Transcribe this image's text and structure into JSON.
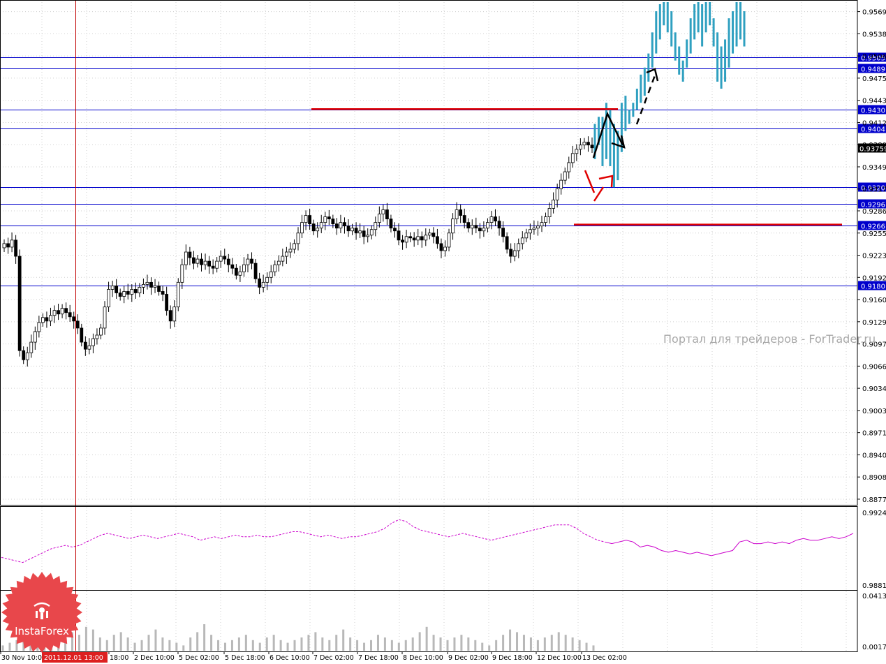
{
  "watermark": "Портал для трейдеров - ForTrader.ru",
  "logo": {
    "text": "InstaForex",
    "color": "#e8474b"
  },
  "colors": {
    "candle": "#000000",
    "projection": "#2fa0c0",
    "level": "#0000cc",
    "red_line": "#e00000",
    "indicator": "#cc00cc",
    "volume": "#b8b8b8",
    "vline": "#c00000"
  },
  "chart_data": [
    {
      "type": "candlestick",
      "ylim": [
        0.887,
        0.9583
      ],
      "y_ticks": [
        "0.95695",
        "0.95380",
        "0.95065",
        "0.94750",
        "0.94435",
        "0.94120",
        "0.93805",
        "0.93490",
        "0.93175",
        "0.92865",
        "0.92550",
        "0.92235",
        "0.91920",
        "0.91605",
        "0.91290",
        "0.90975",
        "0.90660",
        "0.90345",
        "0.90030",
        "0.89715",
        "0.89400",
        "0.89085",
        "0.88770"
      ],
      "x_ticks": [
        "30 Nov 10:00",
        "2011.12.01 13:00",
        "18:00",
        "2 Dec 10:00",
        "5 Dec 02:00",
        "5 Dec 18:00",
        "6 Dec 10:00",
        "7 Dec 02:00",
        "7 Dec 18:00",
        "8 Dec 10:00",
        "9 Dec 02:00",
        "9 Dec 18:00",
        "12 Dec 10:00",
        "13 Dec 02:00"
      ],
      "current_price": "0.93759",
      "levels": [
        {
          "price": 0.9505,
          "label": "0.9505"
        },
        {
          "price": 0.9489,
          "label": "0.9489"
        },
        {
          "price": 0.943,
          "label": "0.9430"
        },
        {
          "price": 0.9404,
          "label": "0.9404"
        },
        {
          "price": 0.932,
          "label": "0.9320"
        },
        {
          "price": 0.9296,
          "label": "0.9296"
        },
        {
          "price": 0.9266,
          "label": "0.9266"
        },
        {
          "price": 0.918,
          "label": "0.9180"
        }
      ],
      "closes": [
        0.924,
        0.9235,
        0.9245,
        0.9222,
        0.9088,
        0.9075,
        0.9085,
        0.91,
        0.9115,
        0.9128,
        0.9135,
        0.913,
        0.9138,
        0.9145,
        0.914,
        0.9148,
        0.9142,
        0.9136,
        0.913,
        0.912,
        0.91,
        0.909,
        0.9095,
        0.9105,
        0.911,
        0.912,
        0.915,
        0.9175,
        0.918,
        0.917,
        0.9165,
        0.9172,
        0.9168,
        0.9175,
        0.917,
        0.9178,
        0.9182,
        0.9185,
        0.9178,
        0.918,
        0.9172,
        0.9168,
        0.9145,
        0.913,
        0.915,
        0.9185,
        0.921,
        0.9228,
        0.922,
        0.9212,
        0.9218,
        0.921,
        0.9215,
        0.9208,
        0.9205,
        0.9215,
        0.9222,
        0.9218,
        0.921,
        0.9205,
        0.9195,
        0.92,
        0.921,
        0.9218,
        0.9212,
        0.919,
        0.9178,
        0.9185,
        0.9192,
        0.92,
        0.921,
        0.9215,
        0.9222,
        0.9228,
        0.9232,
        0.924,
        0.9255,
        0.927,
        0.928,
        0.9268,
        0.9258,
        0.9262,
        0.927,
        0.9278,
        0.9275,
        0.9268,
        0.9262,
        0.927,
        0.9265,
        0.9258,
        0.9262,
        0.9255,
        0.9258,
        0.925,
        0.9252,
        0.926,
        0.927,
        0.9282,
        0.9288,
        0.9275,
        0.9262,
        0.9258,
        0.9245,
        0.9242,
        0.925,
        0.9248,
        0.9245,
        0.925,
        0.9245,
        0.9252,
        0.9255,
        0.925,
        0.924,
        0.923,
        0.9235,
        0.9255,
        0.9275,
        0.9288,
        0.928,
        0.927,
        0.9262,
        0.9266,
        0.9262,
        0.9258,
        0.9262,
        0.927,
        0.9278,
        0.9272,
        0.9262,
        0.925,
        0.9232,
        0.9222,
        0.923,
        0.924,
        0.9248,
        0.9255,
        0.926,
        0.9262,
        0.9265,
        0.927,
        0.9278,
        0.929,
        0.9302,
        0.9318,
        0.933,
        0.9342,
        0.9355,
        0.9368,
        0.9374,
        0.938,
        0.9384,
        0.938,
        0.9376
      ],
      "projection": [
        [
          0.936,
          0.941
        ],
        [
          0.938,
          0.942
        ],
        [
          0.935,
          0.942
        ],
        [
          0.936,
          0.944
        ],
        [
          0.935,
          0.943
        ],
        [
          0.932,
          0.941
        ],
        [
          0.933,
          0.94
        ],
        [
          0.937,
          0.944
        ],
        [
          0.94,
          0.945
        ],
        [
          0.941,
          0.943
        ],
        [
          0.942,
          0.944
        ],
        [
          0.943,
          0.946
        ],
        [
          0.944,
          0.948
        ],
        [
          0.945,
          0.949
        ],
        [
          0.947,
          0.951
        ],
        [
          0.949,
          0.954
        ],
        [
          0.951,
          0.957
        ],
        [
          0.953,
          0.958
        ],
        [
          0.955,
          0.9583
        ],
        [
          0.954,
          0.9583
        ],
        [
          0.952,
          0.957
        ],
        [
          0.95,
          0.954
        ],
        [
          0.948,
          0.952
        ],
        [
          0.947,
          0.95
        ],
        [
          0.949,
          0.953
        ],
        [
          0.951,
          0.956
        ],
        [
          0.953,
          0.958
        ],
        [
          0.954,
          0.9583
        ],
        [
          0.952,
          0.958
        ],
        [
          0.954,
          0.9583
        ],
        [
          0.955,
          0.9583
        ],
        [
          0.952,
          0.956
        ],
        [
          0.947,
          0.954
        ],
        [
          0.946,
          0.952
        ],
        [
          0.947,
          0.953
        ],
        [
          0.949,
          0.956
        ],
        [
          0.951,
          0.957
        ],
        [
          0.952,
          0.9583
        ],
        [
          0.953,
          0.9583
        ],
        [
          0.952,
          0.957
        ]
      ]
    },
    {
      "type": "line",
      "ylim": [
        0.98818,
        0.99242
      ],
      "y_ticks": [
        "0.99242",
        "0.98818"
      ],
      "values": [
        0.9898,
        0.9897,
        0.9896,
        0.9895,
        0.9897,
        0.9899,
        0.9901,
        0.9903,
        0.9904,
        0.9905,
        0.9904,
        0.9905,
        0.9907,
        0.9909,
        0.9911,
        0.9912,
        0.9911,
        0.991,
        0.9909,
        0.991,
        0.9911,
        0.991,
        0.9909,
        0.991,
        0.9911,
        0.9912,
        0.9911,
        0.991,
        0.9908,
        0.9909,
        0.991,
        0.9909,
        0.991,
        0.9911,
        0.991,
        0.991,
        0.9911,
        0.991,
        0.991,
        0.9911,
        0.9912,
        0.9913,
        0.9913,
        0.9912,
        0.9911,
        0.991,
        0.9911,
        0.991,
        0.9909,
        0.991,
        0.991,
        0.9911,
        0.9912,
        0.9913,
        0.9915,
        0.9918,
        0.992,
        0.9919,
        0.9916,
        0.9914,
        0.9913,
        0.9912,
        0.9911,
        0.991,
        0.9911,
        0.9912,
        0.9911,
        0.991,
        0.9909,
        0.9908,
        0.9909,
        0.991,
        0.9911,
        0.9912,
        0.9913,
        0.9914,
        0.9915,
        0.9916,
        0.9917,
        0.9917,
        0.9917,
        0.9915,
        0.9912,
        0.991,
        0.9908,
        0.9907,
        0.9906,
        0.9907,
        0.9908,
        0.9907,
        0.9904,
        0.9905,
        0.9904,
        0.9902,
        0.9901,
        0.9902,
        0.9901,
        0.99,
        0.9901,
        0.99,
        0.9899,
        0.99,
        0.9901,
        0.9902,
        0.9907,
        0.9908,
        0.9906,
        0.9906,
        0.9907,
        0.9906,
        0.9907,
        0.9906,
        0.9908,
        0.9909,
        0.9908,
        0.9908,
        0.9909,
        0.991,
        0.9909,
        0.991,
        0.9912
      ]
    },
    {
      "type": "bar",
      "y_ticks": [
        "0.04132",
        "0.00172"
      ],
      "values": [
        2,
        3,
        4,
        6,
        5,
        8,
        6,
        4,
        3,
        5,
        7,
        6,
        9,
        8,
        5,
        4,
        6,
        7,
        5,
        3,
        4,
        6,
        8,
        5,
        4,
        3,
        2,
        5,
        7,
        10,
        6,
        4,
        3,
        4,
        5,
        6,
        4,
        3,
        5,
        6,
        4,
        3,
        4,
        5,
        6,
        7,
        5,
        4,
        6,
        8,
        5,
        4,
        3,
        4,
        6,
        5,
        4,
        3,
        4,
        5,
        7,
        9,
        6,
        5,
        4,
        5,
        6,
        5,
        4,
        3,
        2,
        4,
        6,
        8,
        7,
        6,
        5,
        4,
        5,
        6,
        7,
        6,
        5,
        4,
        3,
        2
      ]
    }
  ]
}
